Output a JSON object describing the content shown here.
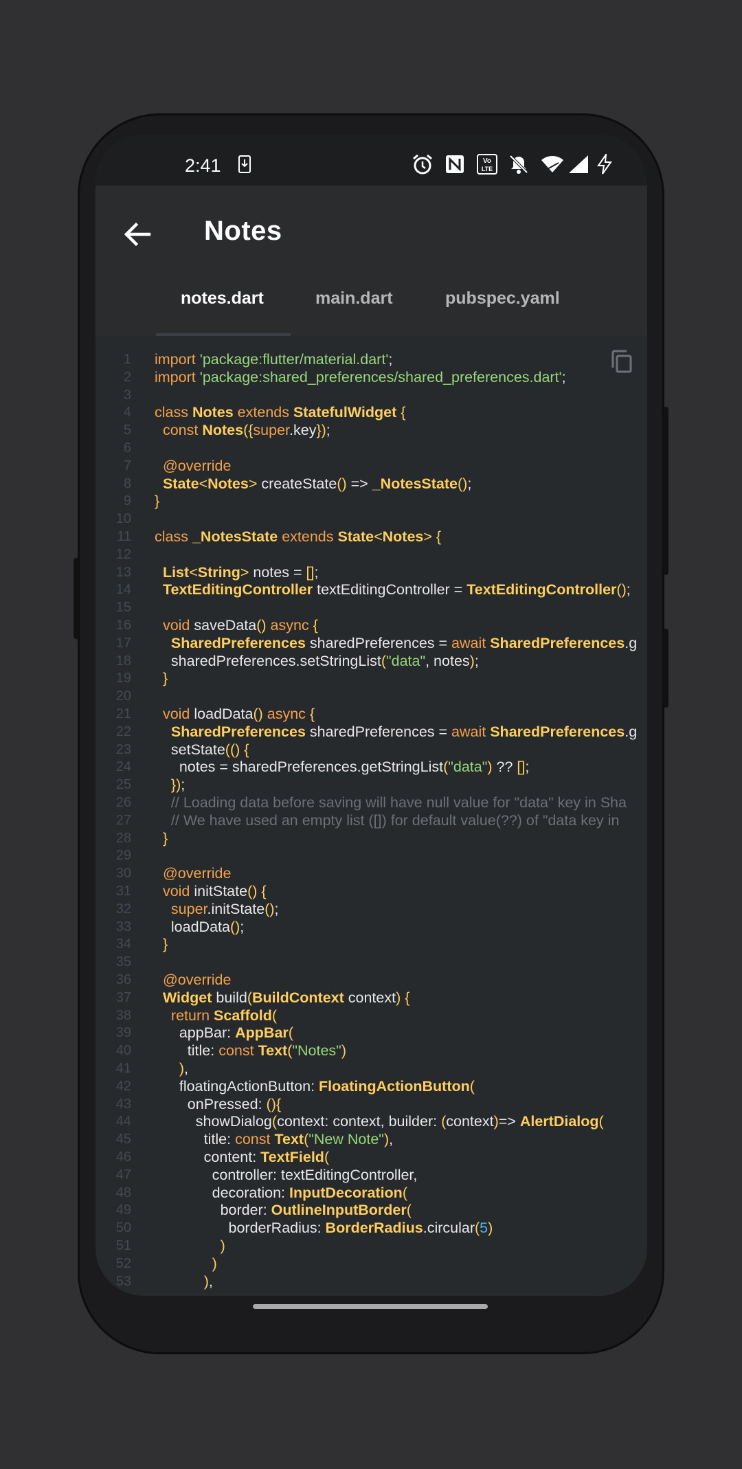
{
  "status": {
    "time": "2:41",
    "icons": [
      "download-icon",
      "alarm-icon",
      "nfc-icon",
      "volte-icon",
      "notifications-off-icon",
      "wifi-icon",
      "signal-icon",
      "charging-icon"
    ]
  },
  "appbar": {
    "back_icon": "arrow-back-icon",
    "title": "Notes"
  },
  "tabs": [
    {
      "label": "notes.dart",
      "active": true
    },
    {
      "label": "main.dart",
      "active": false
    },
    {
      "label": "pubspec.yaml",
      "active": false
    }
  ],
  "code": {
    "copy_icon": "copy-icon",
    "lines": [
      [
        [
          "k",
          "import "
        ],
        [
          "s",
          "'package:flutter/material.dart'"
        ],
        [
          "d",
          ";"
        ]
      ],
      [
        [
          "k",
          "import "
        ],
        [
          "s",
          "'package:shared_preferences/shared_preferences.dart'"
        ],
        [
          "d",
          ";"
        ]
      ],
      [],
      [
        [
          "k",
          "class "
        ],
        [
          "t",
          "Notes"
        ],
        [
          "k",
          " extends "
        ],
        [
          "t",
          "StatefulWidget"
        ],
        [
          "p",
          " {"
        ]
      ],
      [
        [
          "d",
          "  "
        ],
        [
          "k",
          "const "
        ],
        [
          "t",
          "Notes"
        ],
        [
          "p",
          "({"
        ],
        [
          "k",
          "super"
        ],
        [
          "d",
          ".key"
        ],
        [
          "p",
          "})"
        ],
        [
          "d",
          ";"
        ]
      ],
      [],
      [
        [
          "d",
          "  "
        ],
        [
          "k",
          "@override"
        ]
      ],
      [
        [
          "d",
          "  "
        ],
        [
          "t",
          "State"
        ],
        [
          "p",
          "<"
        ],
        [
          "t",
          "Notes"
        ],
        [
          "p",
          "> "
        ],
        [
          "d",
          "createState"
        ],
        [
          "p",
          "() "
        ],
        [
          "d",
          "=> "
        ],
        [
          "t",
          "_NotesState"
        ],
        [
          "p",
          "()"
        ],
        [
          "d",
          ";"
        ]
      ],
      [
        [
          "p",
          "}"
        ]
      ],
      [],
      [
        [
          "k",
          "class "
        ],
        [
          "t",
          "_NotesState"
        ],
        [
          "k",
          " extends "
        ],
        [
          "t",
          "State"
        ],
        [
          "p",
          "<"
        ],
        [
          "t",
          "Notes"
        ],
        [
          "p",
          "> {"
        ]
      ],
      [],
      [
        [
          "d",
          "  "
        ],
        [
          "t",
          "List"
        ],
        [
          "p",
          "<"
        ],
        [
          "t",
          "String"
        ],
        [
          "p",
          "> "
        ],
        [
          "d",
          "notes = "
        ],
        [
          "p",
          "[]"
        ],
        [
          "d",
          ";"
        ]
      ],
      [
        [
          "d",
          "  "
        ],
        [
          "t",
          "TextEditingController"
        ],
        [
          "d",
          " textEditingController = "
        ],
        [
          "t",
          "TextEditingController"
        ],
        [
          "p",
          "()"
        ],
        [
          "d",
          ";"
        ]
      ],
      [],
      [
        [
          "d",
          "  "
        ],
        [
          "k",
          "void "
        ],
        [
          "d",
          "saveData"
        ],
        [
          "p",
          "() "
        ],
        [
          "k",
          "async "
        ],
        [
          "p",
          "{"
        ]
      ],
      [
        [
          "d",
          "    "
        ],
        [
          "t",
          "SharedPreferences"
        ],
        [
          "d",
          " sharedPreferences = "
        ],
        [
          "k",
          "await "
        ],
        [
          "t",
          "SharedPreferences"
        ],
        [
          "d",
          ".g"
        ]
      ],
      [
        [
          "d",
          "    sharedPreferences.setStringList"
        ],
        [
          "p",
          "("
        ],
        [
          "s",
          "\"data\""
        ],
        [
          "d",
          ", notes"
        ],
        [
          "p",
          ")"
        ],
        [
          "d",
          ";"
        ]
      ],
      [
        [
          "d",
          "  "
        ],
        [
          "p",
          "}"
        ]
      ],
      [],
      [
        [
          "d",
          "  "
        ],
        [
          "k",
          "void "
        ],
        [
          "d",
          "loadData"
        ],
        [
          "p",
          "() "
        ],
        [
          "k",
          "async "
        ],
        [
          "p",
          "{"
        ]
      ],
      [
        [
          "d",
          "    "
        ],
        [
          "t",
          "SharedPreferences"
        ],
        [
          "d",
          " sharedPreferences = "
        ],
        [
          "k",
          "await "
        ],
        [
          "t",
          "SharedPreferences"
        ],
        [
          "d",
          ".g"
        ]
      ],
      [
        [
          "d",
          "    setState"
        ],
        [
          "p",
          "(() {"
        ]
      ],
      [
        [
          "d",
          "      notes = sharedPreferences.getStringList"
        ],
        [
          "p",
          "("
        ],
        [
          "s",
          "\"data\""
        ],
        [
          "p",
          ") "
        ],
        [
          "d",
          "?? "
        ],
        [
          "p",
          "[]"
        ],
        [
          "d",
          ";"
        ]
      ],
      [
        [
          "d",
          "    "
        ],
        [
          "p",
          "})"
        ],
        [
          "d",
          ";"
        ]
      ],
      [
        [
          "c",
          "    // Loading data before saving will have null value for \"data\" key in Sha"
        ]
      ],
      [
        [
          "c",
          "    // We have used an empty list ([]) for default value(??) of \"data key in"
        ]
      ],
      [
        [
          "d",
          "  "
        ],
        [
          "p",
          "}"
        ]
      ],
      [],
      [
        [
          "d",
          "  "
        ],
        [
          "k",
          "@override"
        ]
      ],
      [
        [
          "d",
          "  "
        ],
        [
          "k",
          "void "
        ],
        [
          "d",
          "initState"
        ],
        [
          "p",
          "() {"
        ]
      ],
      [
        [
          "d",
          "    "
        ],
        [
          "k",
          "super"
        ],
        [
          "d",
          ".initState"
        ],
        [
          "p",
          "()"
        ],
        [
          "d",
          ";"
        ]
      ],
      [
        [
          "d",
          "    loadData"
        ],
        [
          "p",
          "()"
        ],
        [
          "d",
          ";"
        ]
      ],
      [
        [
          "d",
          "  "
        ],
        [
          "p",
          "}"
        ]
      ],
      [],
      [
        [
          "d",
          "  "
        ],
        [
          "k",
          "@override"
        ]
      ],
      [
        [
          "d",
          "  "
        ],
        [
          "t",
          "Widget"
        ],
        [
          "d",
          " build"
        ],
        [
          "p",
          "("
        ],
        [
          "t",
          "BuildContext"
        ],
        [
          "d",
          " context"
        ],
        [
          "p",
          ") {"
        ]
      ],
      [
        [
          "d",
          "    "
        ],
        [
          "k",
          "return "
        ],
        [
          "t",
          "Scaffold"
        ],
        [
          "p",
          "("
        ]
      ],
      [
        [
          "d",
          "      appBar: "
        ],
        [
          "t",
          "AppBar"
        ],
        [
          "p",
          "("
        ]
      ],
      [
        [
          "d",
          "        title: "
        ],
        [
          "k",
          "const "
        ],
        [
          "t",
          "Text"
        ],
        [
          "p",
          "("
        ],
        [
          "s",
          "\"Notes\""
        ],
        [
          "p",
          ")"
        ]
      ],
      [
        [
          "d",
          "      "
        ],
        [
          "p",
          ")"
        ],
        [
          "d",
          ","
        ]
      ],
      [
        [
          "d",
          "      floatingActionButton: "
        ],
        [
          "t",
          "FloatingActionButton"
        ],
        [
          "p",
          "("
        ]
      ],
      [
        [
          "d",
          "        onPressed: "
        ],
        [
          "p",
          "(){"
        ]
      ],
      [
        [
          "d",
          "          showDialog"
        ],
        [
          "p",
          "("
        ],
        [
          "d",
          "context: context, builder: "
        ],
        [
          "p",
          "("
        ],
        [
          "d",
          "context"
        ],
        [
          "p",
          ")"
        ],
        [
          "d",
          "=> "
        ],
        [
          "t",
          "AlertDialog"
        ],
        [
          "p",
          "("
        ]
      ],
      [
        [
          "d",
          "            title: "
        ],
        [
          "k",
          "const "
        ],
        [
          "t",
          "Text"
        ],
        [
          "p",
          "("
        ],
        [
          "s",
          "\"New Note\""
        ],
        [
          "p",
          ")"
        ],
        [
          "d",
          ","
        ]
      ],
      [
        [
          "d",
          "            content: "
        ],
        [
          "t",
          "TextField"
        ],
        [
          "p",
          "("
        ]
      ],
      [
        [
          "d",
          "              controller: textEditingController,"
        ]
      ],
      [
        [
          "d",
          "              decoration: "
        ],
        [
          "t",
          "InputDecoration"
        ],
        [
          "p",
          "("
        ]
      ],
      [
        [
          "d",
          "                border: "
        ],
        [
          "t",
          "OutlineInputBorder"
        ],
        [
          "p",
          "("
        ]
      ],
      [
        [
          "d",
          "                  borderRadius: "
        ],
        [
          "t",
          "BorderRadius"
        ],
        [
          "d",
          ".circular"
        ],
        [
          "p",
          "("
        ],
        [
          "n",
          "5"
        ],
        [
          "p",
          ")"
        ]
      ],
      [
        [
          "d",
          "                "
        ],
        [
          "p",
          ")"
        ]
      ],
      [
        [
          "d",
          "              "
        ],
        [
          "p",
          ")"
        ]
      ],
      [
        [
          "d",
          "            "
        ],
        [
          "p",
          ")"
        ],
        [
          "d",
          ","
        ]
      ]
    ]
  }
}
